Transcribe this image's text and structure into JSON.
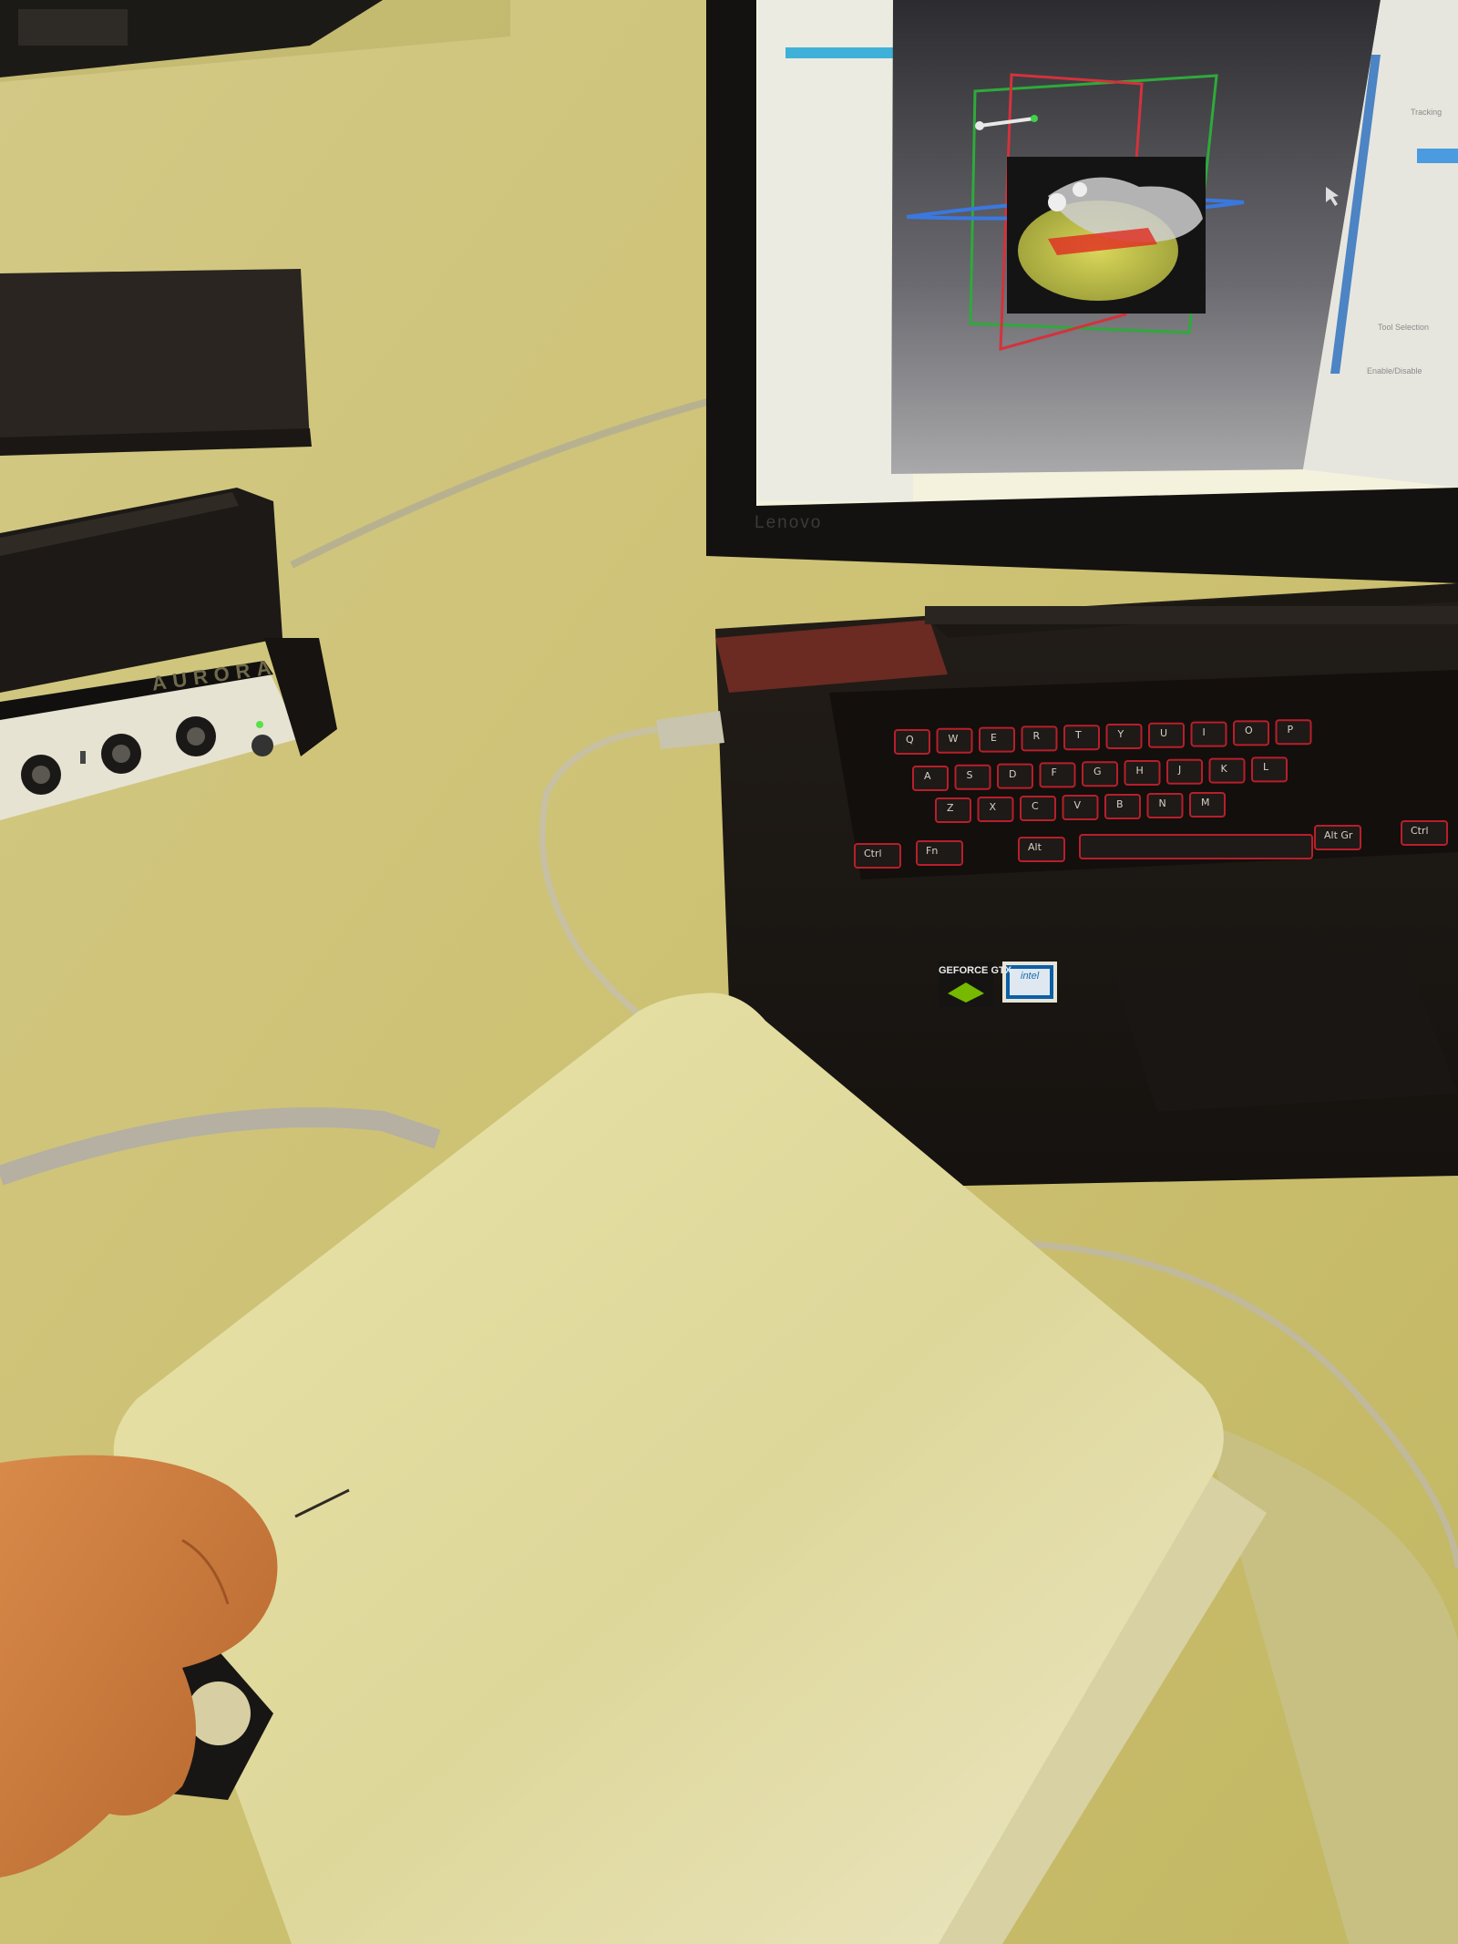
{
  "photo": {
    "devices": {
      "tracking_unit_brand": "AURORA",
      "laptop_brand": "Lenovo",
      "gpu_sticker": "GEFORCE GTX",
      "cpu_sticker": "intel"
    },
    "screen": {
      "side_panel_labels": [
        "Tracking",
        "Tool Selection",
        "Enable/Disable"
      ]
    },
    "keyboard": {
      "row_q": [
        "Q",
        "W",
        "E",
        "R",
        "T",
        "Y",
        "U",
        "I",
        "O",
        "P"
      ],
      "row_a": [
        "A",
        "S",
        "D",
        "F",
        "G",
        "H",
        "J",
        "K",
        "L"
      ],
      "row_z": [
        "Z",
        "X",
        "C",
        "V",
        "B",
        "N",
        "M"
      ],
      "mods": [
        "Ctrl",
        "Fn",
        "Alt",
        "Alt Gr",
        "Ctrl"
      ]
    },
    "colors": {
      "desk": "#cfc47a",
      "laptop_body": "#1f1a16",
      "key_backlight": "#c0202a",
      "panel": "#e8e2a8"
    }
  }
}
